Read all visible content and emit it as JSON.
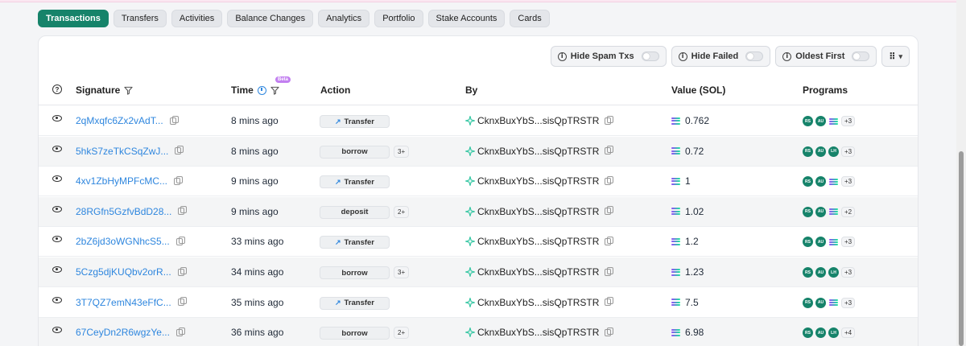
{
  "tabs": [
    {
      "label": "Transactions",
      "active": true
    },
    {
      "label": "Transfers"
    },
    {
      "label": "Activities"
    },
    {
      "label": "Balance Changes"
    },
    {
      "label": "Analytics"
    },
    {
      "label": "Portfolio"
    },
    {
      "label": "Stake Accounts"
    },
    {
      "label": "Cards"
    }
  ],
  "toolbar": {
    "hide_spam": "Hide Spam Txs",
    "hide_failed": "Hide Failed",
    "oldest_first": "Oldest First"
  },
  "columns": {
    "signature": "Signature",
    "time": "Time",
    "beta": "Beta",
    "action": "Action",
    "by": "By",
    "value": "Value (SOL)",
    "programs": "Programs"
  },
  "rows": [
    {
      "signature": "2qMxqfc6Zx2vAdT...",
      "time": "8 mins ago",
      "action": "Transfer",
      "action_icon": "arrow-up-right",
      "extra": "",
      "by": "CknxBuxYbS...sisQpTRSTR",
      "value": "0.762",
      "programs": [
        "RS",
        "AU",
        "SOL"
      ],
      "more": "+3"
    },
    {
      "signature": "5hkS7zeTkCSqZwJ...",
      "time": "8 mins ago",
      "action": "borrow",
      "action_icon": "",
      "extra": "3+",
      "by": "CknxBuxYbS...sisQpTRSTR",
      "value": "0.72",
      "programs": [
        "RS",
        "AU",
        "LH"
      ],
      "more": "+3"
    },
    {
      "signature": "4xv1ZbHyMPFcMC...",
      "time": "9 mins ago",
      "action": "Transfer",
      "action_icon": "arrow-up-right",
      "extra": "",
      "by": "CknxBuxYbS...sisQpTRSTR",
      "value": "1",
      "programs": [
        "RS",
        "AU",
        "SOL"
      ],
      "more": "+3"
    },
    {
      "signature": "28RGfn5GzfvBdD28...",
      "time": "9 mins ago",
      "action": "deposit",
      "action_icon": "",
      "extra": "2+",
      "by": "CknxBuxYbS...sisQpTRSTR",
      "value": "1.02",
      "programs": [
        "RS",
        "AU",
        "SOL"
      ],
      "more": "+2"
    },
    {
      "signature": "2bZ6jd3oWGNhcS5...",
      "time": "33 mins ago",
      "action": "Transfer",
      "action_icon": "arrow-up-right",
      "extra": "",
      "by": "CknxBuxYbS...sisQpTRSTR",
      "value": "1.2",
      "programs": [
        "RS",
        "AU",
        "SOL"
      ],
      "more": "+3"
    },
    {
      "signature": "5Czg5djKUQbv2orR...",
      "time": "34 mins ago",
      "action": "borrow",
      "action_icon": "",
      "extra": "3+",
      "by": "CknxBuxYbS...sisQpTRSTR",
      "value": "1.23",
      "programs": [
        "RS",
        "AU",
        "LH"
      ],
      "more": "+3"
    },
    {
      "signature": "3T7QZ7emN43eFfC...",
      "time": "35 mins ago",
      "action": "Transfer",
      "action_icon": "arrow-up-right",
      "extra": "",
      "by": "CknxBuxYbS...sisQpTRSTR",
      "value": "7.5",
      "programs": [
        "RS",
        "AU",
        "SOL"
      ],
      "more": "+3"
    },
    {
      "signature": "67CeyDn2R6wgzYe...",
      "time": "36 mins ago",
      "action": "borrow",
      "action_icon": "",
      "extra": "2+",
      "by": "CknxBuxYbS...sisQpTRSTR",
      "value": "6.98",
      "programs": [
        "RS",
        "AU",
        "LH"
      ],
      "more": "+4"
    }
  ],
  "colors": {
    "accent": "#16836a",
    "link": "#2e86de",
    "beta": "#c27ff0"
  }
}
